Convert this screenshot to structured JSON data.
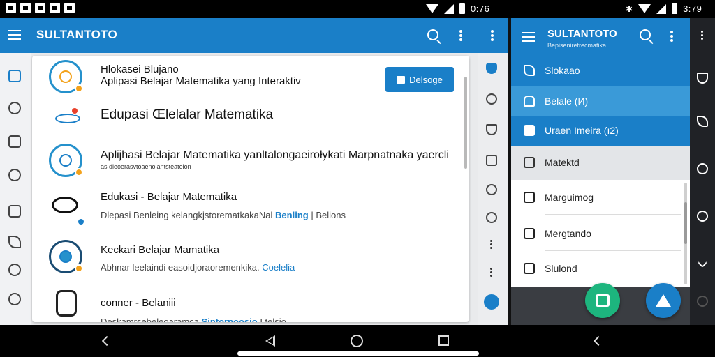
{
  "status_bar": {
    "time_left": "0:76",
    "time_right": "3:79"
  },
  "left_app": {
    "title": "SULTANTOTO",
    "list": [
      {
        "title": "Hlokasei Blujano",
        "subtitle": "Aplipasi Belajar Matematika yang Interaktiv",
        "button_label": "Delsoge"
      },
      {
        "title": "Edupasi Œlelalar Matematika"
      },
      {
        "title": "Aplijhasi Belajar Matematika yanltalongaeirołykati Marpnatnaka yaercli",
        "tiny": "as dleoerasvtoaenolantsteatelon"
      },
      {
        "title": "Edukasi - Belajar Matematika",
        "subtitle_prefix": "Dlepasi Benleing kelangkjstorematkakaNal",
        "subtitle_highlight": "Benling",
        "subtitle_suffix": "| Belions"
      },
      {
        "title": "Keckari Belajar Mamatika",
        "subtitle_prefix": "Abhnar leelaindi easoidjoraoremenkika.",
        "subtitle_highlight": "Coelelia"
      },
      {
        "title": "conner - Belaniii",
        "subtitle_prefix": "Deskamrsebeleoaramca",
        "subtitle_highlight": "Sintornoosio",
        "subtitle_suffix": "I telsio"
      }
    ]
  },
  "drawer": {
    "title": "SULTANTOTO",
    "subtitle": "Bepiseniretrecmatika",
    "blue_items": [
      {
        "label": "Slokaao"
      },
      {
        "label": "Belale (И)"
      },
      {
        "label": "Uraen Imeira (ı2)"
      }
    ],
    "light_item": {
      "label": "Matektd"
    },
    "list_items": [
      {
        "label": "Marguimog"
      },
      {
        "label": "Mergtando"
      },
      {
        "label": "Slulond"
      }
    ]
  },
  "colors": {
    "primary": "#1a7fc8",
    "drawer_active": "#3a9ad8",
    "fab_green": "#1db57e"
  }
}
